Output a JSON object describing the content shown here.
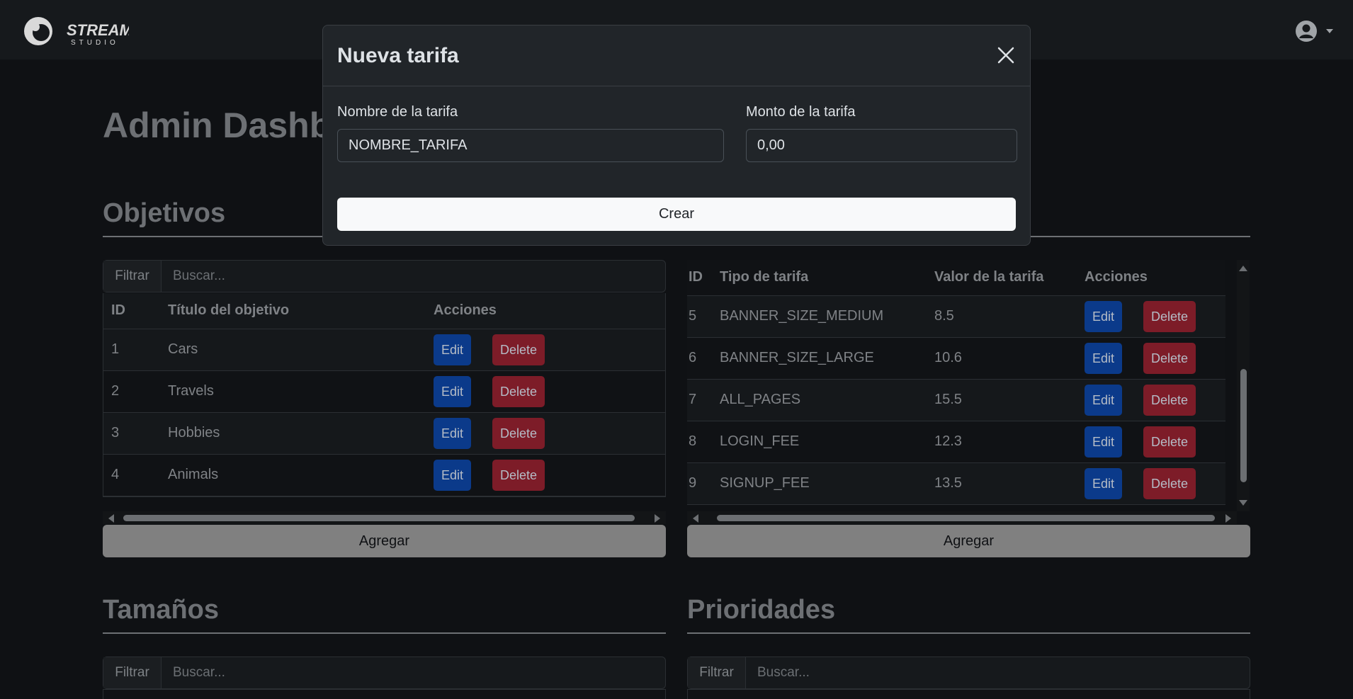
{
  "brand": {
    "logo_text": "STREAMING",
    "logo_subtext": "STUDIO"
  },
  "page": {
    "title": "Admin Dashboard"
  },
  "sections": {
    "objetivos": {
      "title": "Objetivos"
    },
    "tamanos": {
      "title": "Tamaños"
    },
    "prioridades": {
      "title": "Prioridades"
    }
  },
  "filter": {
    "label": "Filtrar",
    "placeholder": "Buscar..."
  },
  "objetivos_table": {
    "headers": [
      "ID",
      "Título del objetivo",
      "Acciones"
    ],
    "rows": [
      {
        "id": "1",
        "title": "Cars"
      },
      {
        "id": "2",
        "title": "Travels"
      },
      {
        "id": "3",
        "title": "Hobbies"
      },
      {
        "id": "4",
        "title": "Animals"
      }
    ]
  },
  "tarifas_table": {
    "headers": [
      "ID",
      "Tipo de tarifa",
      "Valor de la tarifa",
      "Acciones"
    ],
    "rows": [
      {
        "id": "5",
        "tipo": "BANNER_SIZE_MEDIUM",
        "valor": "8.5"
      },
      {
        "id": "6",
        "tipo": "BANNER_SIZE_LARGE",
        "valor": "10.6"
      },
      {
        "id": "7",
        "tipo": "ALL_PAGES",
        "valor": "15.5"
      },
      {
        "id": "8",
        "tipo": "LOGIN_FEE",
        "valor": "12.3"
      },
      {
        "id": "9",
        "tipo": "SIGNUP_FEE",
        "valor": "13.5"
      }
    ]
  },
  "actions": {
    "edit_label": "Edit",
    "delete_label": "Delete",
    "add_label": "Agregar"
  },
  "modal": {
    "title": "Nueva tarifa",
    "name_label": "Nombre de la tarifa",
    "name_value": "NOMBRE_TARIFA",
    "amount_label": "Monto de la tarifa",
    "amount_value": "0,00",
    "submit_label": "Crear"
  },
  "icons": {
    "logo": "streaming-studio-logo",
    "user": "user-circle-icon",
    "caret": "caret-down-icon",
    "close": "close-icon"
  },
  "colors": {
    "background": "#0f1114",
    "modal_bg": "#212529",
    "edit": "#0b3a8a",
    "delete": "#7d1c28",
    "add_button": "#808080"
  }
}
